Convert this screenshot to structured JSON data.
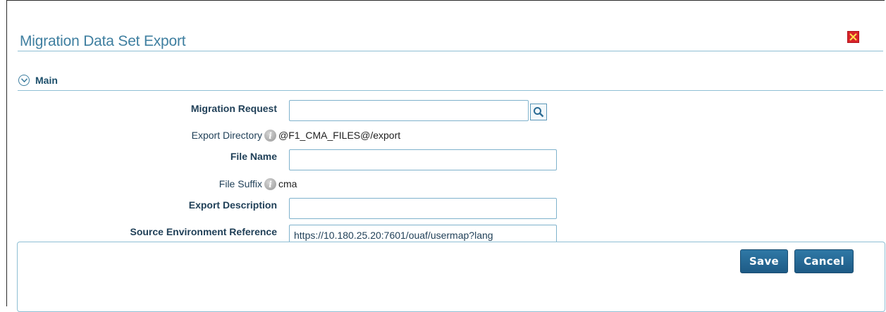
{
  "dialog": {
    "title": "Migration Data Set Export",
    "close_icon": "close-icon"
  },
  "section": {
    "label": "Main",
    "toggle_icon": "chevron-down-circle-icon"
  },
  "form": {
    "migration_request": {
      "label": "Migration Request",
      "value": "",
      "search_icon": "search-icon"
    },
    "export_directory": {
      "label": "Export Directory",
      "info_icon": "info-icon",
      "value": "@F1_CMA_FILES@/export"
    },
    "file_name": {
      "label": "File Name",
      "value": ""
    },
    "file_suffix": {
      "label": "File Suffix",
      "info_icon": "info-icon",
      "value": "cma"
    },
    "export_description": {
      "label": "Export Description",
      "value": ""
    },
    "source_environment_reference": {
      "label": "Source Environment Reference",
      "value": "https://10.180.25.20:7601/ouaf/usermap?lang"
    }
  },
  "actions": {
    "save_label": "Save",
    "cancel_label": "Cancel"
  },
  "colors": {
    "title": "#3f7fa0",
    "button": "#1e5b86",
    "close": "#d8232a",
    "border": "#8fbfd4"
  }
}
